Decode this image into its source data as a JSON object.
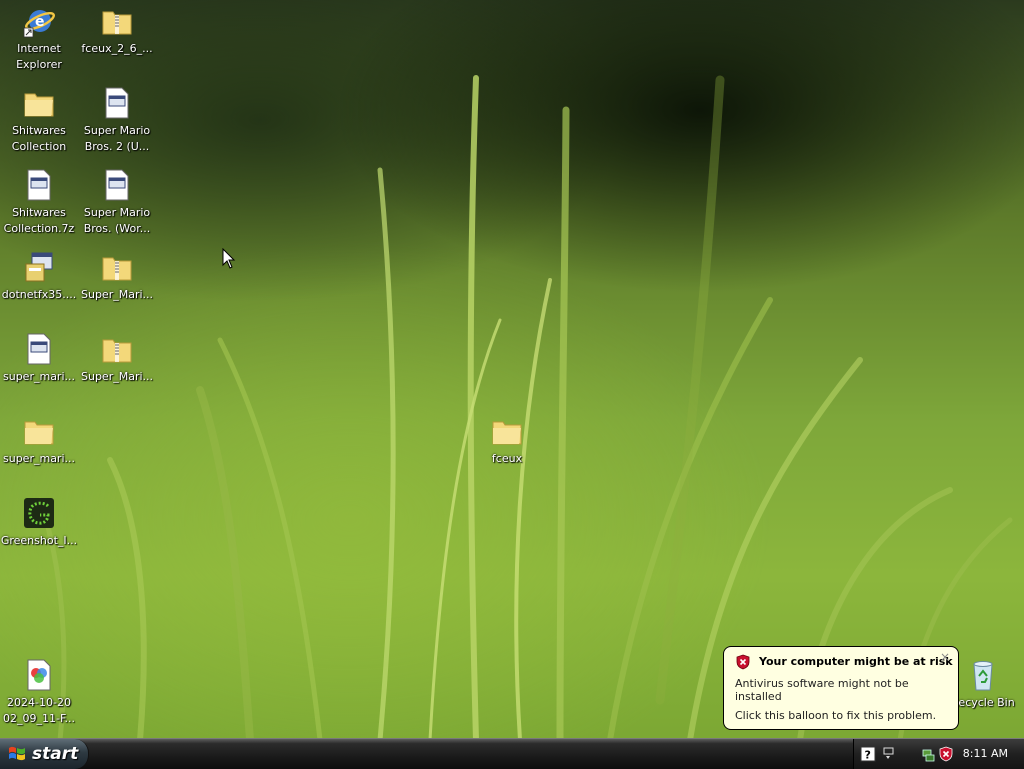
{
  "desktop": {
    "icons": [
      {
        "label": "Internet Explorer",
        "icon": "internet-explorer-icon"
      },
      {
        "label": "fceux_2_6_...",
        "icon": "zip-folder-icon"
      },
      {
        "label": "Shitwares Collection",
        "icon": "folder-icon"
      },
      {
        "label": "Super Mario Bros. 2 (U...",
        "icon": "file-icon"
      },
      {
        "label": "Shitwares Collection.7z",
        "icon": "file-icon"
      },
      {
        "label": "Super Mario Bros. (Wor...",
        "icon": "file-icon"
      },
      {
        "label": "dotnetfx35....",
        "icon": "installer-icon"
      },
      {
        "label": "Super_Mari...",
        "icon": "zip-folder-icon"
      },
      {
        "label": "super_mari...",
        "icon": "file-icon"
      },
      {
        "label": "Super_Mari...",
        "icon": "zip-folder-icon"
      },
      {
        "label": "super_mari...",
        "icon": "folder-icon"
      },
      {
        "label": "fceux",
        "icon": "folder-icon"
      },
      {
        "label": "Greenshot_I...",
        "icon": "greenshot-icon"
      },
      {
        "label": "2024-10-20 02_09_11-F...",
        "icon": "image-file-icon"
      },
      {
        "label": "Recycle Bin",
        "icon": "recycle-bin-icon"
      }
    ]
  },
  "taskbar": {
    "start_label": "start",
    "clock": "8:11 AM"
  },
  "balloon": {
    "title": "Your computer might be at risk",
    "line1": "Antivirus software might not be installed",
    "line2": "Click this balloon to fix this problem.",
    "close": "×"
  },
  "colors": {
    "balloon_bg": "#ffffe1",
    "taskbar": "#1a1a1a",
    "shield_red": "#c8102e"
  }
}
